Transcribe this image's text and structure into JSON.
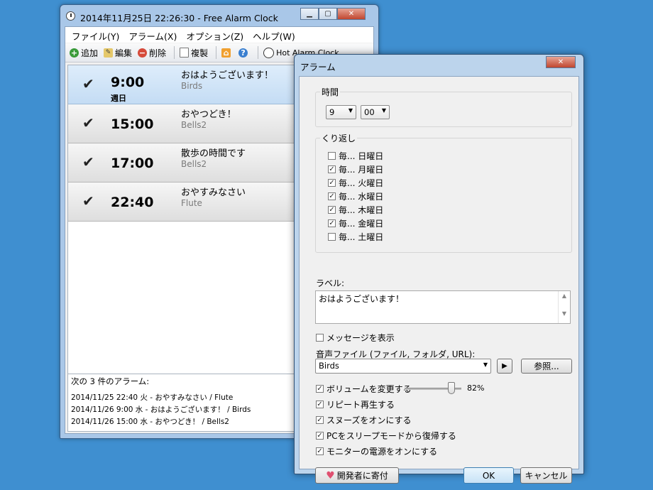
{
  "main": {
    "title": "2014年11月25日 22:26:30 - Free Alarm Clock",
    "minimize": "▁",
    "maximize": "▢",
    "close": "✕",
    "menu": [
      "ファイル(Y)",
      "アラーム(X)",
      "オプション(Z)",
      "ヘルプ(W)"
    ],
    "toolbar": {
      "add": "追加",
      "edit": "編集",
      "delete": "削除",
      "copy": "複製",
      "hot": "Hot Alarm Clock"
    },
    "alarms": [
      {
        "checked": "✔",
        "time": "9:00",
        "days": "週日",
        "label": "おはようございます！",
        "sound": "Birds"
      },
      {
        "checked": "✔",
        "time": "15:00",
        "days": "",
        "label": "おやつどき！",
        "sound": "Bells2"
      },
      {
        "checked": "✔",
        "time": "17:00",
        "days": "",
        "label": "散歩の時間です",
        "sound": "Bells2"
      },
      {
        "checked": "✔",
        "time": "22:40",
        "days": "",
        "label": "おやすみなさい",
        "sound": "Flute"
      }
    ],
    "next": {
      "title": "次の 3 件のアラーム:",
      "items": [
        "2014/11/25 22:40 火 - おやすみなさい / Flute",
        "2014/11/26 9:00 水 - おはようございます！ / Birds",
        "2014/11/26 15:00 水 - おやつどき！ / Bells2"
      ]
    }
  },
  "dialog": {
    "title": "アラーム",
    "close": "✕",
    "time_group": "時間",
    "hour": "9",
    "minute": "00",
    "repeat_group": "くり返し",
    "days": [
      {
        "label": "毎... 日曜日",
        "checked": ""
      },
      {
        "label": "毎... 月曜日",
        "checked": "✓"
      },
      {
        "label": "毎... 火曜日",
        "checked": "✓"
      },
      {
        "label": "毎... 水曜日",
        "checked": "✓"
      },
      {
        "label": "毎... 木曜日",
        "checked": "✓"
      },
      {
        "label": "毎... 金曜日",
        "checked": "✓"
      },
      {
        "label": "毎... 土曜日",
        "checked": ""
      }
    ],
    "label_caption": "ラベル:",
    "label_value": "おはようございます！",
    "show_message": {
      "label": "メッセージを表示",
      "checked": ""
    },
    "sound_caption": "音声ファイル (ファイル, フォルダ, URL):",
    "sound_value": "Birds",
    "play": "▶",
    "browse": "参照...",
    "options": [
      {
        "label": "ボリュームを変更する",
        "checked": "✓"
      },
      {
        "label": "リピート再生する",
        "checked": "✓"
      },
      {
        "label": "スヌーズをオンにする",
        "checked": "✓"
      },
      {
        "label": "PCをスリープモードから復帰する",
        "checked": "✓"
      },
      {
        "label": "モニターの電源をオンにする",
        "checked": "✓"
      }
    ],
    "volume": "82%",
    "volume_fraction": 0.82,
    "donate": "開発者に寄付",
    "ok": "OK",
    "cancel": "キャンセル"
  }
}
